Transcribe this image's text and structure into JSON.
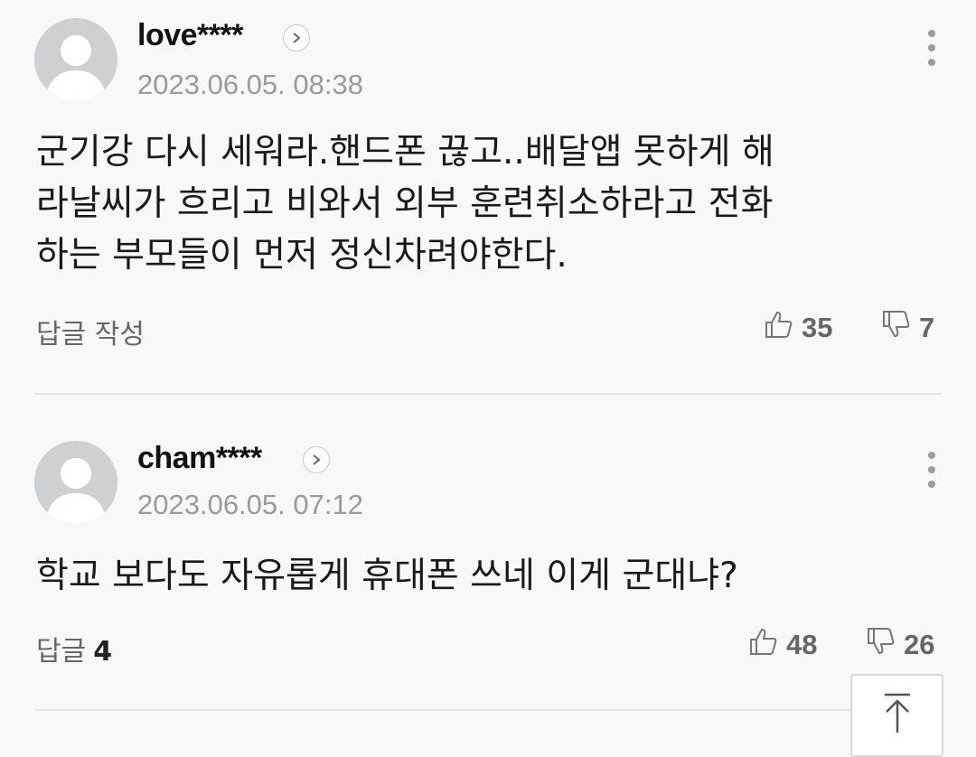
{
  "comments": [
    {
      "username": "love****",
      "timestamp": "2023.06.05. 08:38",
      "body": "군기강 다시 세워라.핸드폰 끊고..배달앱 못하게 해\n라날씨가 흐리고 비와서 외부 훈련취소하라고 전화\n하는 부모들이 먼저 정신차려야한다.",
      "reply_label": "답글 작성",
      "reply_count": "",
      "likes": "35",
      "dislikes": "7"
    },
    {
      "username": "cham****",
      "timestamp": "2023.06.05. 07:12",
      "body": "학교 보다도 자유롭게 휴대폰 쓰네 이게 군대냐?",
      "reply_label": "답글",
      "reply_count": "4",
      "likes": "48",
      "dislikes": "26"
    }
  ],
  "icons": {
    "avatar": "default-avatar-icon",
    "profile": "chevron-right-icon",
    "more": "more-vertical-icon",
    "like": "thumbs-up-icon",
    "dislike": "thumbs-down-icon",
    "scroll_top": "arrow-up-icon"
  },
  "colors": {
    "background": "#f8f8f8",
    "avatar_bg": "#cfd0d2",
    "muted_text": "#9a9a9a"
  }
}
